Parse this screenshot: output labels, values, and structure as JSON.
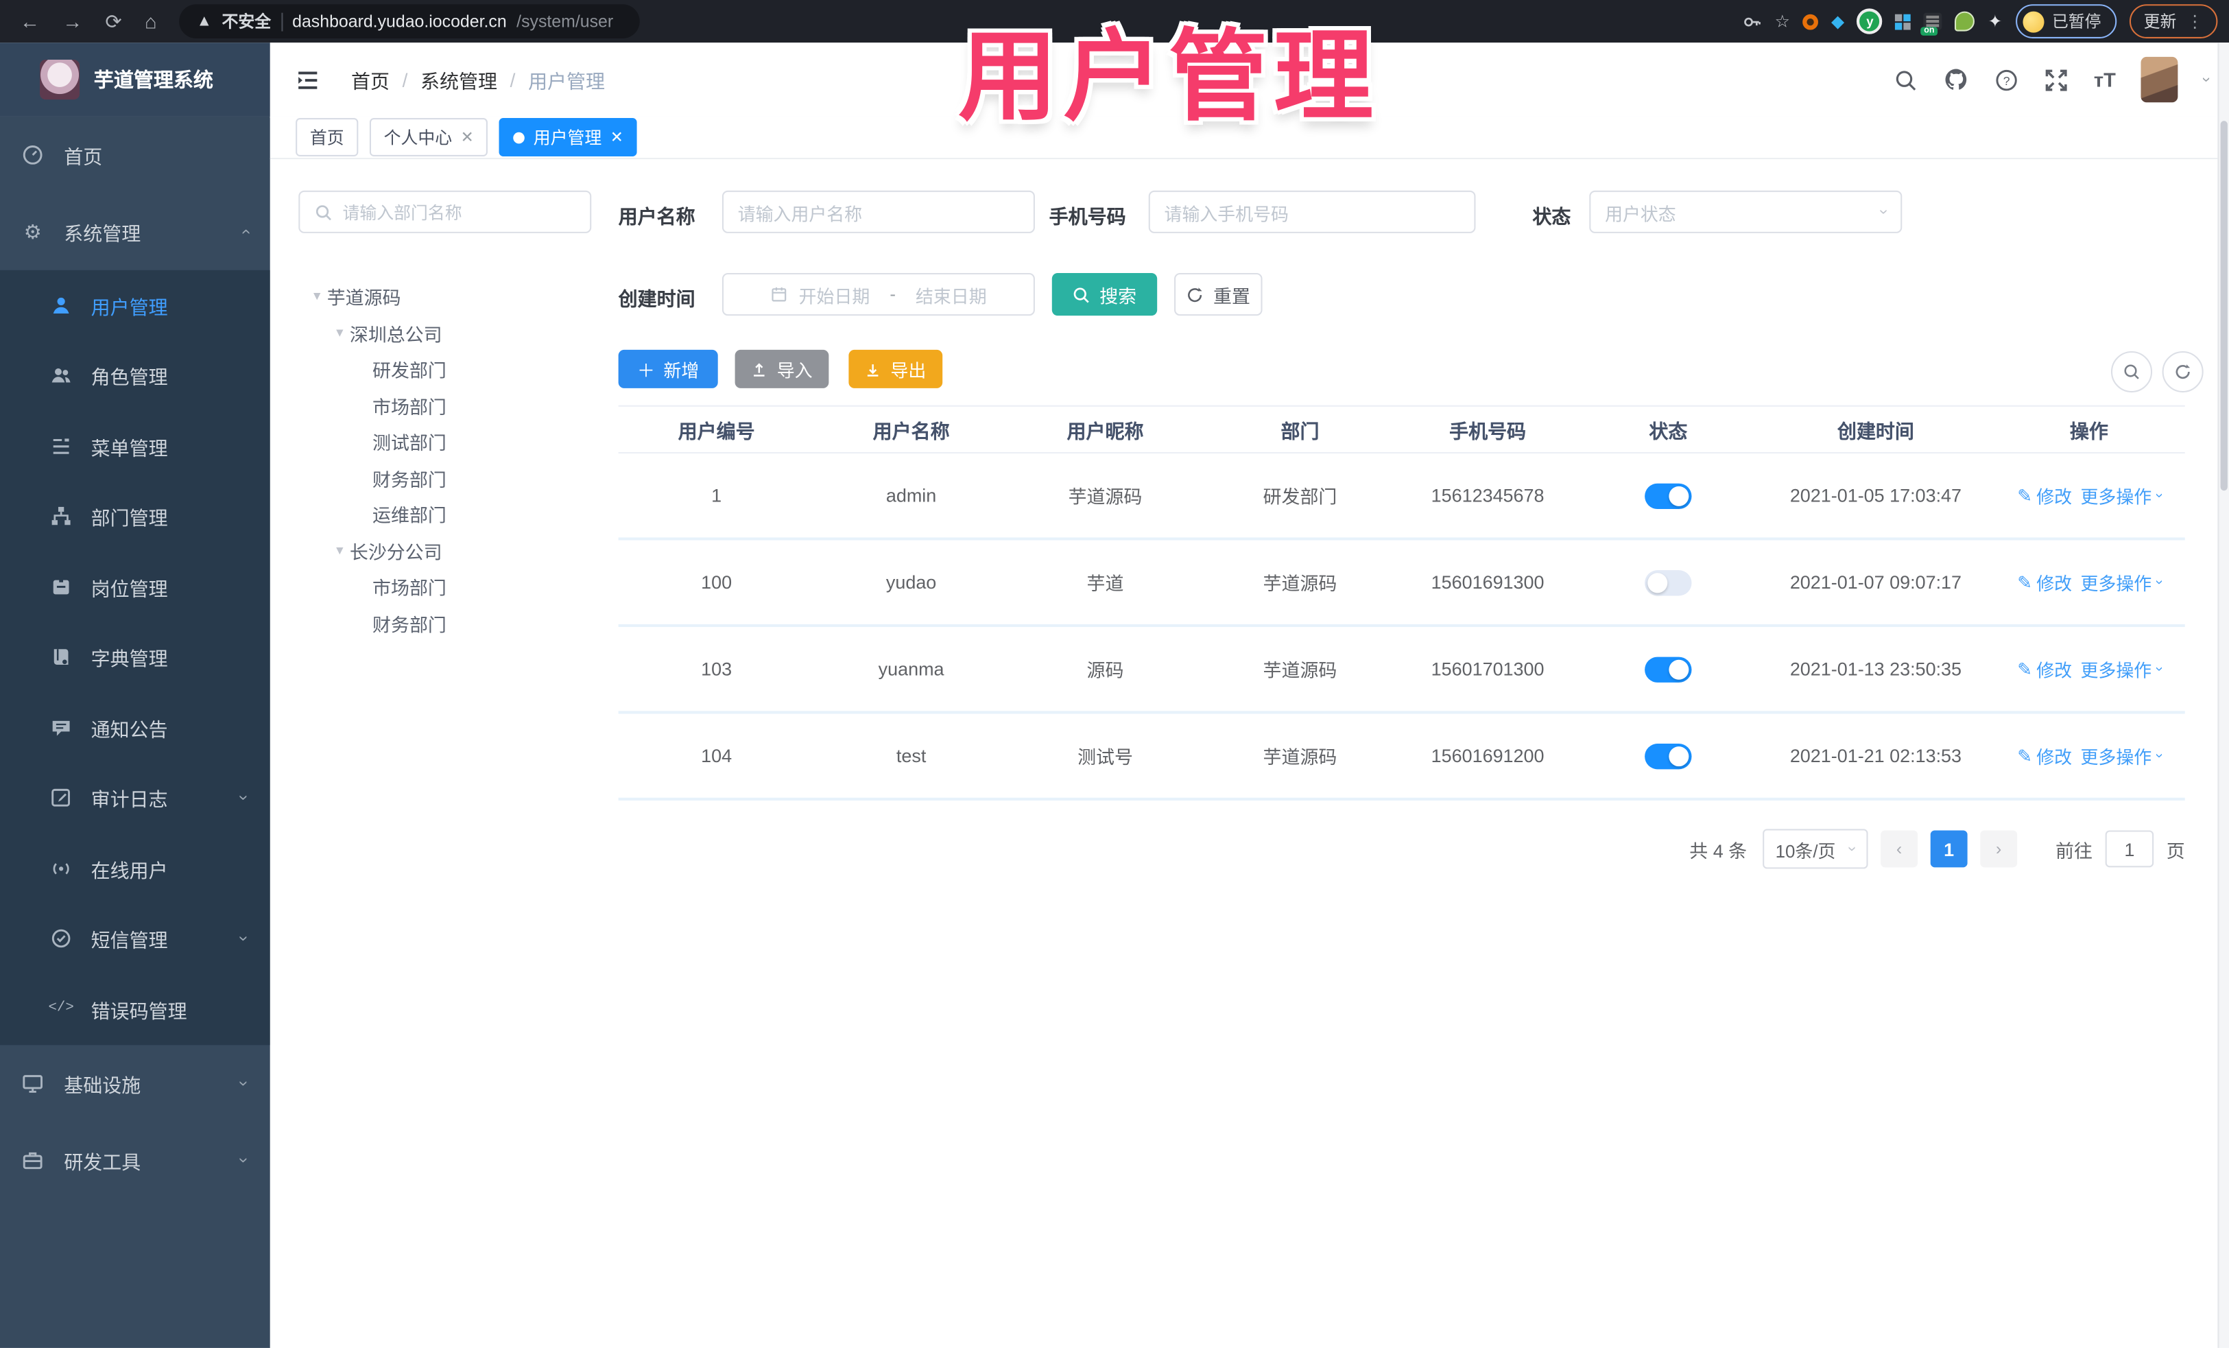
{
  "overlay": {
    "title": "用户管理",
    "color": "#f53c6b"
  },
  "browser": {
    "insecure_label": "不安全",
    "url_host": "dashboard.yudao.iocoder.cn",
    "url_path": "/system/user",
    "profile_label": "已暂停",
    "update_label": "更新"
  },
  "app": {
    "title": "芋道管理系统"
  },
  "breadcrumb": {
    "items": [
      {
        "label": "首页"
      },
      {
        "label": "系统管理"
      },
      {
        "label": "用户管理"
      }
    ]
  },
  "tabs": [
    {
      "label": "首页"
    },
    {
      "label": "个人中心"
    },
    {
      "label": "用户管理"
    }
  ],
  "sidebar": {
    "items": [
      {
        "label": "首页"
      },
      {
        "label": "系统管理"
      },
      {
        "label": "用户管理"
      },
      {
        "label": "角色管理"
      },
      {
        "label": "菜单管理"
      },
      {
        "label": "部门管理"
      },
      {
        "label": "岗位管理"
      },
      {
        "label": "字典管理"
      },
      {
        "label": "通知公告"
      },
      {
        "label": "审计日志"
      },
      {
        "label": "在线用户"
      },
      {
        "label": "短信管理"
      },
      {
        "label": "错误码管理"
      },
      {
        "label": "基础设施"
      },
      {
        "label": "研发工具"
      }
    ]
  },
  "tree": {
    "search_placeholder": "请输入部门名称",
    "nodes": [
      {
        "label": "芋道源码"
      },
      {
        "label": "深圳总公司"
      },
      {
        "label": "研发部门"
      },
      {
        "label": "市场部门"
      },
      {
        "label": "测试部门"
      },
      {
        "label": "财务部门"
      },
      {
        "label": "运维部门"
      },
      {
        "label": "长沙分公司"
      },
      {
        "label": "市场部门"
      },
      {
        "label": "财务部门"
      }
    ]
  },
  "filters": {
    "username_label": "用户名称",
    "username_placeholder": "请输入用户名称",
    "mobile_label": "手机号码",
    "mobile_placeholder": "请输入手机号码",
    "status_label": "状态",
    "status_placeholder": "用户状态",
    "created_label": "创建时间",
    "date_start_placeholder": "开始日期",
    "date_separator": "-",
    "date_end_placeholder": "结束日期",
    "search_label": "搜索",
    "reset_label": "重置"
  },
  "toolbar": {
    "add_label": "新增",
    "import_label": "导入",
    "export_label": "导出"
  },
  "table": {
    "columns": [
      {
        "label": "用户编号"
      },
      {
        "label": "用户名称"
      },
      {
        "label": "用户昵称"
      },
      {
        "label": "部门"
      },
      {
        "label": "手机号码"
      },
      {
        "label": "状态"
      },
      {
        "label": "创建时间"
      },
      {
        "label": "操作"
      }
    ],
    "edit_label": "修改",
    "more_label": "更多操作",
    "rows": [
      {
        "id": "1",
        "username": "admin",
        "nickname": "芋道源码",
        "dept": "研发部门",
        "mobile": "15612345678",
        "status": "on",
        "created": "2021-01-05 17:03:47"
      },
      {
        "id": "100",
        "username": "yudao",
        "nickname": "芋道",
        "dept": "芋道源码",
        "mobile": "15601691300",
        "status": "off",
        "created": "2021-01-07 09:07:17"
      },
      {
        "id": "103",
        "username": "yuanma",
        "nickname": "源码",
        "dept": "芋道源码",
        "mobile": "15601701300",
        "status": "on",
        "created": "2021-01-13 23:50:35"
      },
      {
        "id": "104",
        "username": "test",
        "nickname": "测试号",
        "dept": "芋道源码",
        "mobile": "15601691200",
        "status": "on",
        "created": "2021-01-21 02:13:53"
      }
    ]
  },
  "pagination": {
    "total_label": "共 4 条",
    "page_size_label": "10条/页",
    "prev_label": "‹",
    "current_page": "1",
    "next_label": "›",
    "goto_label": "前往",
    "goto_value": "1",
    "page_unit_label": "页"
  },
  "colors": {
    "accent_blue": "#1890ff",
    "link_blue": "#419ef9",
    "search_teal": "#2bb2a2",
    "add_blue": "#2d8cf0",
    "import_grey": "#909399",
    "export_orange": "#f2a81d",
    "overlay_pink": "#f53c6b",
    "sidebar_bg": "#374a5e",
    "submenu_bg": "#283a4c",
    "browser_bar_bg": "#1f2229"
  }
}
